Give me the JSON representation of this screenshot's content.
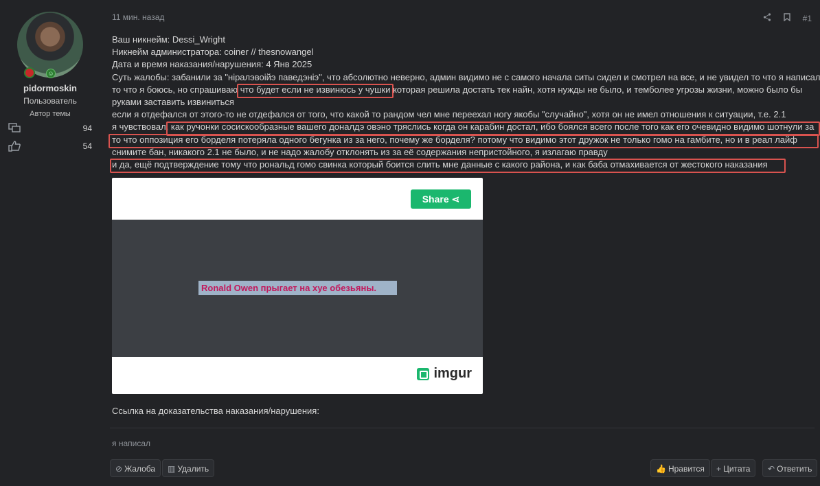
{
  "user": {
    "name": "pidormoskin",
    "role": "Пользователь",
    "author_tag": "Автор темы",
    "messages": "94",
    "reactions": "54"
  },
  "meta": {
    "time": "11 мин. назад",
    "post_number": "#1"
  },
  "post": {
    "lines": [
      "Ваш никнейм: Dessi_Wright",
      "Никнейм администратора: coiner // thesnowangel",
      "Дата и время наказания/нарушения: 4 Янв 2025",
      "Суть жалобы: забанили за \"ніралэвоійэ паведэніэ\", что абсолютно неверно, админ видимо не с самого начала ситы сидел и смотрел на все, и не увидел то что я написал",
      "то что я боюсь, но спрашиваю что будет если не извинюсь у чушки которая решила достать тек найн, хотя нужды не было, и темболее угрозы жизни, можно было бы",
      "руками заставить извиниться",
      "если я отдефался от этого-то не отдефался от того, что какой то рандом чел мне переехал ногу якобы \"случайно\", хотя он не имел отношения к ситуации, т.е. 2.1",
      "я чувствовал, как ручонки сосискообразные вашего доналдэ овэно тряслись когда он карабин достал, ибо боялся всего после того как его очевидно видимо шотнули за",
      "то что оппозиция его борделя потеряла одного бегунка из за него, почему же борделя? потому что видимо этот дружок не только гомо на гамбите, но и в реал лайф",
      "снимите бан, никакого 2.1 не было, и не надо жалобу отклонять из за её содержания непристойного, я излагаю правду",
      "и да, ещё подтверждение тому что рональд гомо свинка который боится слить мне данные с какого района, и как баба отмахивается от жестокого наказания"
    ],
    "proof_label": "Ссылка на доказательства наказания/нарушения:",
    "last_edit": "я написал"
  },
  "embed": {
    "share_label": "Share",
    "caption": "Ronald Owen прыгает на хуе обезьяны.",
    "brand": "imgur"
  },
  "actions": {
    "report": "Жалоба",
    "delete": "Удалить",
    "like": "Нравится",
    "quote": "Цитата",
    "reply": "Ответить"
  },
  "colors": {
    "highlight": "#d9534f",
    "share_bg": "#1bb76e"
  }
}
